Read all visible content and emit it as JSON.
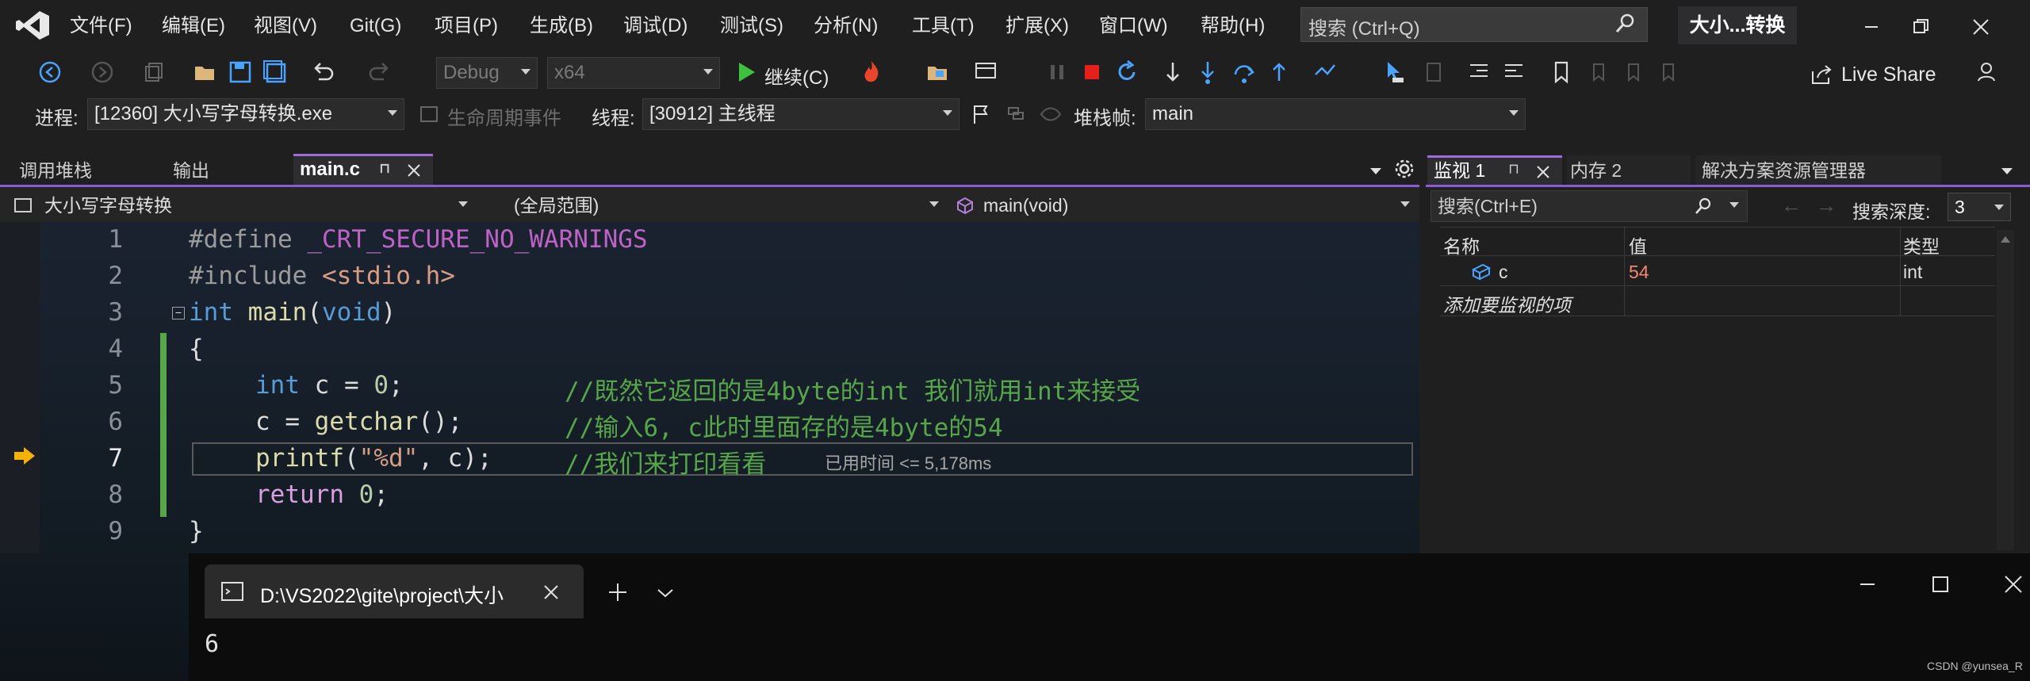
{
  "menu": {
    "items": [
      "文件(F)",
      "编辑(E)",
      "视图(V)",
      "Git(G)",
      "项目(P)",
      "生成(B)",
      "调试(D)",
      "测试(S)",
      "分析(N)",
      "工具(T)",
      "扩展(X)",
      "窗口(W)",
      "帮助(H)"
    ],
    "search_placeholder": "搜索 (Ctrl+Q)",
    "window_title": "大小...转换"
  },
  "toolbar": {
    "config": "Debug",
    "platform": "x64",
    "continue_label": "继续(C)",
    "live_share": "Live Share"
  },
  "debug_location": {
    "process_label": "进程:",
    "process_value": "[12360] 大小写字母转换.exe",
    "lifecycle_label": "生命周期事件",
    "thread_label": "线程:",
    "thread_value": "[30912] 主线程",
    "stackframe_label": "堆栈帧:",
    "stackframe_value": "main"
  },
  "editor": {
    "tabs": [
      "调用堆栈",
      "输出"
    ],
    "active_tab": "main.c",
    "nav_project": "大小写字母转换",
    "nav_scope": "(全局范围)",
    "nav_function": "main(void)",
    "line_numbers": [
      "1",
      "2",
      "3",
      "4",
      "5",
      "6",
      "7",
      "8",
      "9"
    ],
    "code": {
      "l1_pp": "#define",
      "l1_rest": " _CRT_SECURE_NO_WARNINGS",
      "l2_pp": "#include",
      "l2_rest": " <stdio.h>",
      "l3_kw": "int",
      "l3_fn": " main",
      "l3_open": "(",
      "l3_kw2": "void",
      "l3_close": ")",
      "l4": "{",
      "l5_kw": "int",
      "l5_rest": " c = ",
      "l5_num": "0",
      "l5_semi": ";",
      "l5_cm": "//既然它返回的是4byte的int 我们就用int来接受",
      "l6_a": "c = ",
      "l6_fn": "getchar",
      "l6_b": "();",
      "l6_cm": "//输入6, c此时里面存的是4byte的54",
      "l7_fn": "printf",
      "l7_a": "(",
      "l7_str": "\"%d\"",
      "l7_b": ", c);",
      "l7_cm": "//我们来打印看看",
      "l8_kw": "return",
      "l8_sp": " ",
      "l8_num": "0",
      "l8_semi": ";",
      "l9": "}"
    },
    "elapsed": "已用时间 <= 5,178ms"
  },
  "watch": {
    "tab": "监视 1",
    "tabs_other": [
      "内存 2",
      "解决方案资源管理器"
    ],
    "search_placeholder": "搜索(Ctrl+E)",
    "depth_label": "搜索深度:",
    "depth_value": "3",
    "col_name": "名称",
    "col_value": "值",
    "col_type": "类型",
    "rows": [
      {
        "name": "c",
        "value": "54",
        "type": "int"
      }
    ],
    "add_item": "添加要监视的项"
  },
  "console": {
    "title": "D:\\VS2022\\gite\\project\\大小",
    "output": "6"
  },
  "watermark": "CSDN @yunsea_R"
}
